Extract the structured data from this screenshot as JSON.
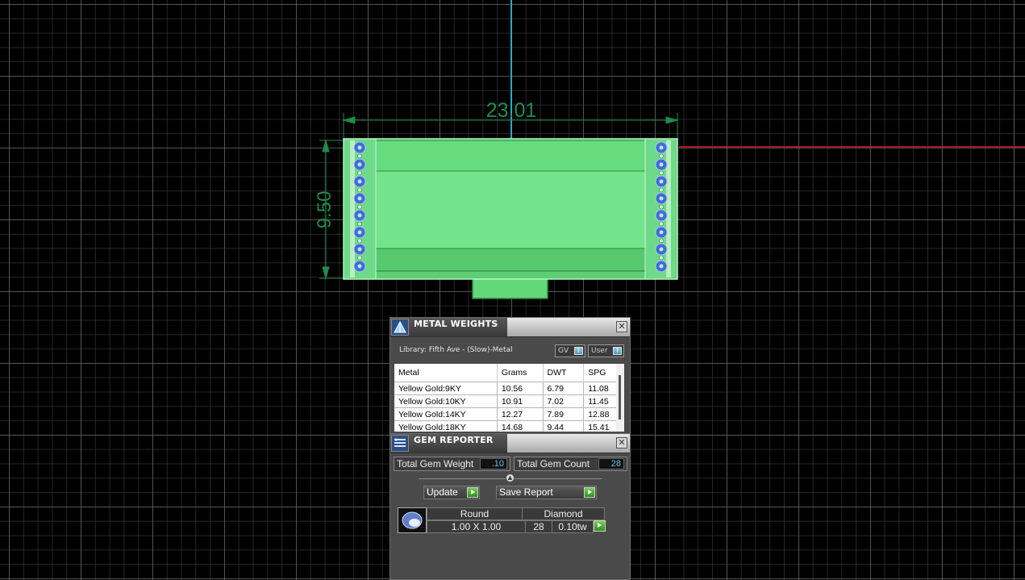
{
  "viewport": {
    "dimension_width": "23.01",
    "dimension_height": "9.50",
    "colors": {
      "axis_x": "#e0141e",
      "axis_y": "#2fa6c4",
      "model": "#6fe08a",
      "dimension": "#1e8a50"
    }
  },
  "metal_weights": {
    "title": "METAL WEIGHTS",
    "library": "Library: Fifth Ave - (Slow)-Metal",
    "toggle_gv": "GV",
    "toggle_user": "User",
    "columns": [
      "Metal",
      "Grams",
      "DWT",
      "SPG"
    ],
    "rows": [
      [
        "Yellow Gold:9KY",
        "10.56",
        "6.79",
        "11.08"
      ],
      [
        "Yellow Gold:10KY",
        "10.91",
        "7.02",
        "11.45"
      ],
      [
        "Yellow Gold:14KY",
        "12.27",
        "7.89",
        "12.88"
      ],
      [
        "Yellow Gold:18KY",
        "14.68",
        "9.44",
        "15.41"
      ]
    ],
    "icon": "pyramid-icon"
  },
  "gem_reporter": {
    "title": "GEM REPORTER",
    "total_weight_label": "Total Gem Weight",
    "total_weight_value": ".10",
    "total_count_label": "Total Gem Count",
    "total_count_value": "28",
    "update_label": "Update",
    "save_label": "Save Report",
    "gem": {
      "shape": "Round",
      "material": "Diamond",
      "size": "1.00 X 1.00",
      "count": "28",
      "weight": "0.10tw"
    },
    "icon": "gem-list-icon"
  }
}
